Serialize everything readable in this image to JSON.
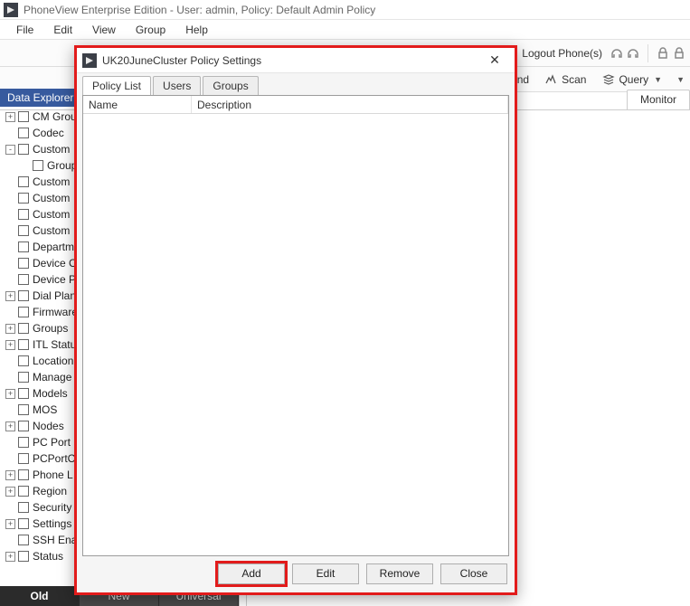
{
  "titlebar": {
    "text": "PhoneView Enterprise Edition - User: admin, Policy: Default Admin Policy"
  },
  "menubar": [
    "File",
    "Edit",
    "View",
    "Group",
    "Help"
  ],
  "toolbar1": {
    "logout_phones": "Logout Phone(s)"
  },
  "toolbar2": {
    "send": "Send",
    "scan": "Scan",
    "query": "Query"
  },
  "main_tabs_left": [
    "Data Explorer"
  ],
  "main_tabs_right": [
    "Monitor"
  ],
  "data_explorer": {
    "title": "Data Explorer",
    "nodes": [
      {
        "d": 0,
        "exp": "+",
        "label": "CM Group"
      },
      {
        "d": 0,
        "exp": "",
        "label": "Codec"
      },
      {
        "d": 0,
        "exp": "-",
        "label": "Custom"
      },
      {
        "d": 1,
        "exp": "",
        "label": "Group"
      },
      {
        "d": 0,
        "exp": "",
        "label": "Custom"
      },
      {
        "d": 0,
        "exp": "",
        "label": "Custom"
      },
      {
        "d": 0,
        "exp": "",
        "label": "Custom"
      },
      {
        "d": 0,
        "exp": "",
        "label": "Custom"
      },
      {
        "d": 0,
        "exp": "",
        "label": "Department"
      },
      {
        "d": 0,
        "exp": "",
        "label": "Device C"
      },
      {
        "d": 0,
        "exp": "",
        "label": "Device P"
      },
      {
        "d": 0,
        "exp": "+",
        "label": "Dial Plan"
      },
      {
        "d": 0,
        "exp": "",
        "label": "Firmware"
      },
      {
        "d": 0,
        "exp": "+",
        "label": "Groups"
      },
      {
        "d": 0,
        "exp": "+",
        "label": "ITL Status"
      },
      {
        "d": 0,
        "exp": "",
        "label": "Location"
      },
      {
        "d": 0,
        "exp": "",
        "label": "Manage"
      },
      {
        "d": 0,
        "exp": "+",
        "label": "Models"
      },
      {
        "d": 0,
        "exp": "",
        "label": "MOS"
      },
      {
        "d": 0,
        "exp": "+",
        "label": "Nodes"
      },
      {
        "d": 0,
        "exp": "",
        "label": "PC Port"
      },
      {
        "d": 0,
        "exp": "",
        "label": "PCPortC"
      },
      {
        "d": 0,
        "exp": "+",
        "label": "Phone L"
      },
      {
        "d": 0,
        "exp": "+",
        "label": "Region"
      },
      {
        "d": 0,
        "exp": "",
        "label": "Security"
      },
      {
        "d": 0,
        "exp": "+",
        "label": "Settings"
      },
      {
        "d": 0,
        "exp": "",
        "label": "SSH Ena"
      },
      {
        "d": 0,
        "exp": "+",
        "label": "Status"
      }
    ],
    "bottom_tabs": [
      "Old",
      "New",
      "Universal"
    ]
  },
  "dialog": {
    "title": "UK20JuneCluster Policy Settings",
    "tabs": [
      "Policy List",
      "Users",
      "Groups"
    ],
    "columns": {
      "name": "Name",
      "description": "Description"
    },
    "buttons": {
      "add": "Add",
      "edit": "Edit",
      "remove": "Remove",
      "close": "Close"
    }
  }
}
